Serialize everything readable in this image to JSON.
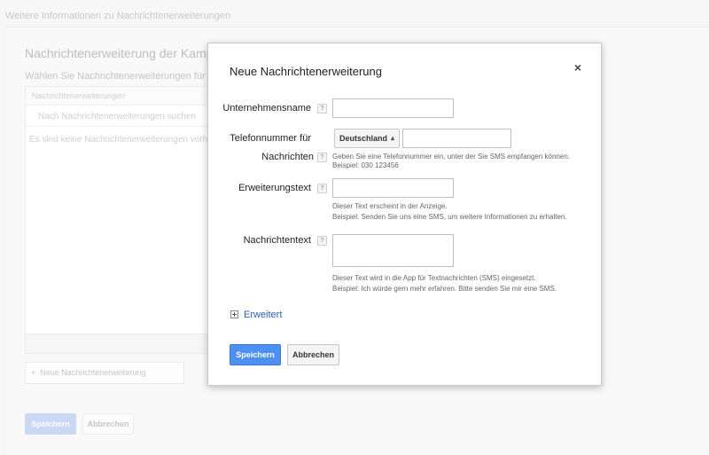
{
  "background": {
    "top_link": "Weitere Informationen zu Nachrichtenerweiterungen",
    "title": "Nachrichtenerweiterung der Kampagne b",
    "subtitle": "Wählen Sie Nachrichtenerweiterungen für dies",
    "table_header": "Nachrichtenerweiterungen",
    "search_placeholder": "Nach Nachrichtenerweiterungen suchen",
    "empty_text": "Es sind keine Nachrichtenerweiterungen vorh",
    "add_button": "Neue Nachrichtenerweiterung",
    "save_button": "Speichern",
    "cancel_button": "Abbrechen"
  },
  "dialog": {
    "title": "Neue Nachrichtenerweiterung",
    "close_symbol": "×",
    "company_label": "Unternehmensname",
    "phone_label_line1": "Telefonnummer für",
    "phone_label_line2": "Nachrichten",
    "country_value": "Deutschland",
    "phone_hint_line1": "Geben Sie eine Telefonnummer ein, unter der Sie SMS empfangen können.",
    "phone_hint_line2": "Beispiel: 030 123456",
    "extension_label": "Erweiterungstext",
    "extension_hint_line1": "Dieser Text erscheint in der Anzeige.",
    "extension_hint_line2": "Beispiel: Senden Sie uns eine SMS, um weitere Informationen zu erhalten.",
    "message_label": "Nachrichtentext",
    "message_hint_line1": "Dieser Text wird in die App für Textnachrichten (SMS) eingesetzt.",
    "message_hint_line2": "Beispiel: Ich würde gern mehr erfahren. Bitte senden Sie mir eine SMS.",
    "help_symbol": "?",
    "advanced_label": "Erweitert",
    "save_button": "Speichern",
    "cancel_button": "Abbrechen"
  }
}
